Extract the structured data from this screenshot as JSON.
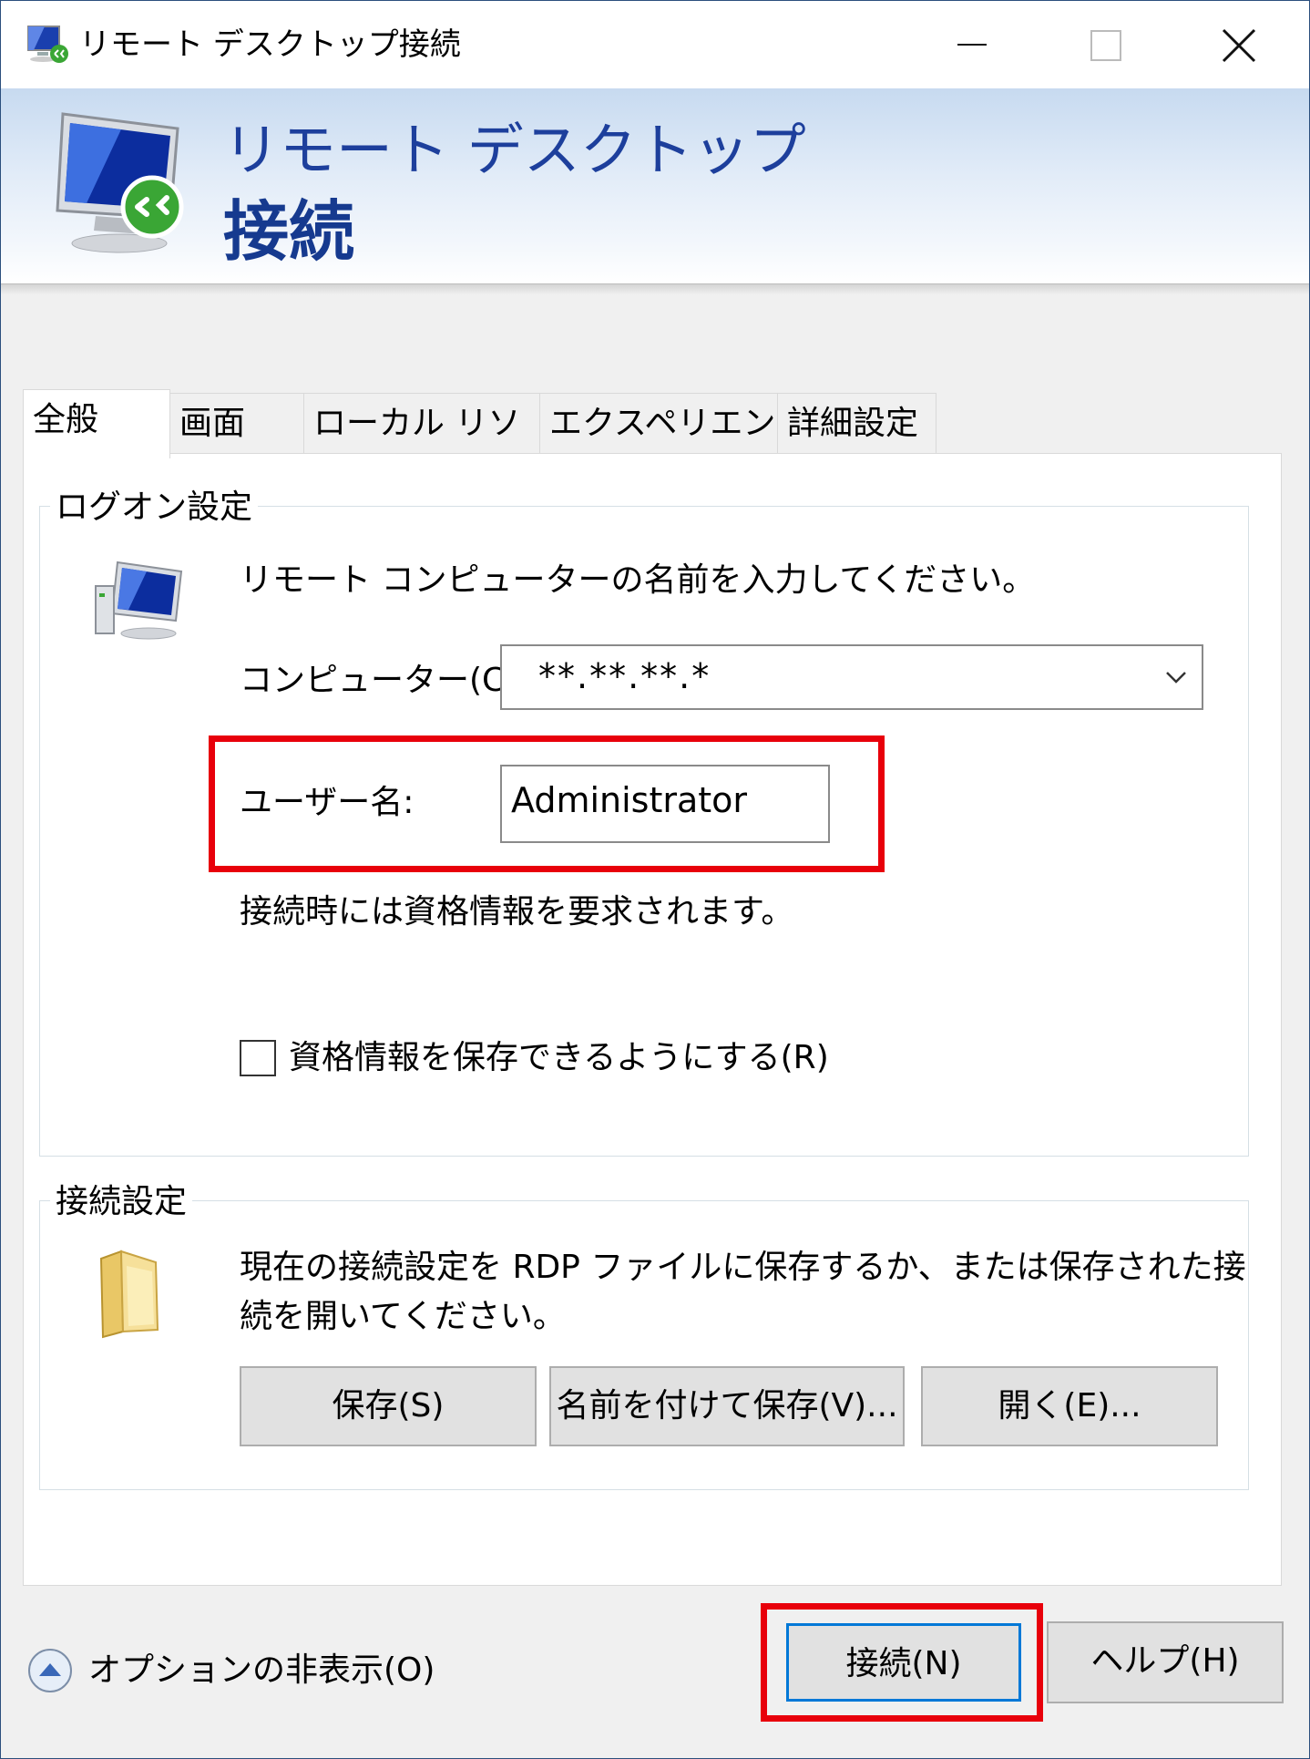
{
  "window": {
    "title": "リモート デスクトップ接続"
  },
  "banner": {
    "line1": "リモート デスクトップ",
    "line2": "接続"
  },
  "tabs": [
    {
      "label": "全般",
      "active": true
    },
    {
      "label": "画面"
    },
    {
      "label": "ローカル リソース"
    },
    {
      "label": "エクスペリエンス"
    },
    {
      "label": "詳細設定"
    }
  ],
  "logon": {
    "group_label": "ログオン設定",
    "instruction": "リモート コンピューターの名前を入力してください。",
    "computer_label": "コンピューター(C):",
    "computer_value": "**.**.**.*",
    "username_label": "ユーザー名:",
    "username_value": "Administrator",
    "credentials_note": "接続時には資格情報を要求されます。",
    "save_credentials_label": "資格情報を保存できるようにする(R)",
    "save_credentials_checked": false
  },
  "connection": {
    "group_label": "接続設定",
    "description_line1": "現在の接続設定を RDP ファイルに保存するか、または保存された接",
    "description_line2": "続を開いてください。",
    "save_button": "保存(S)",
    "save_as_button": "名前を付けて保存(V)...",
    "open_button": "開く(E)..."
  },
  "footer": {
    "hide_options_label": "オプションの非表示(O)",
    "connect_button": "接続(N)",
    "help_button": "ヘルプ(H)"
  },
  "colors": {
    "highlight": "#e8000b",
    "banner_text": "#1d3f9c",
    "default_button_border": "#0078d7"
  }
}
